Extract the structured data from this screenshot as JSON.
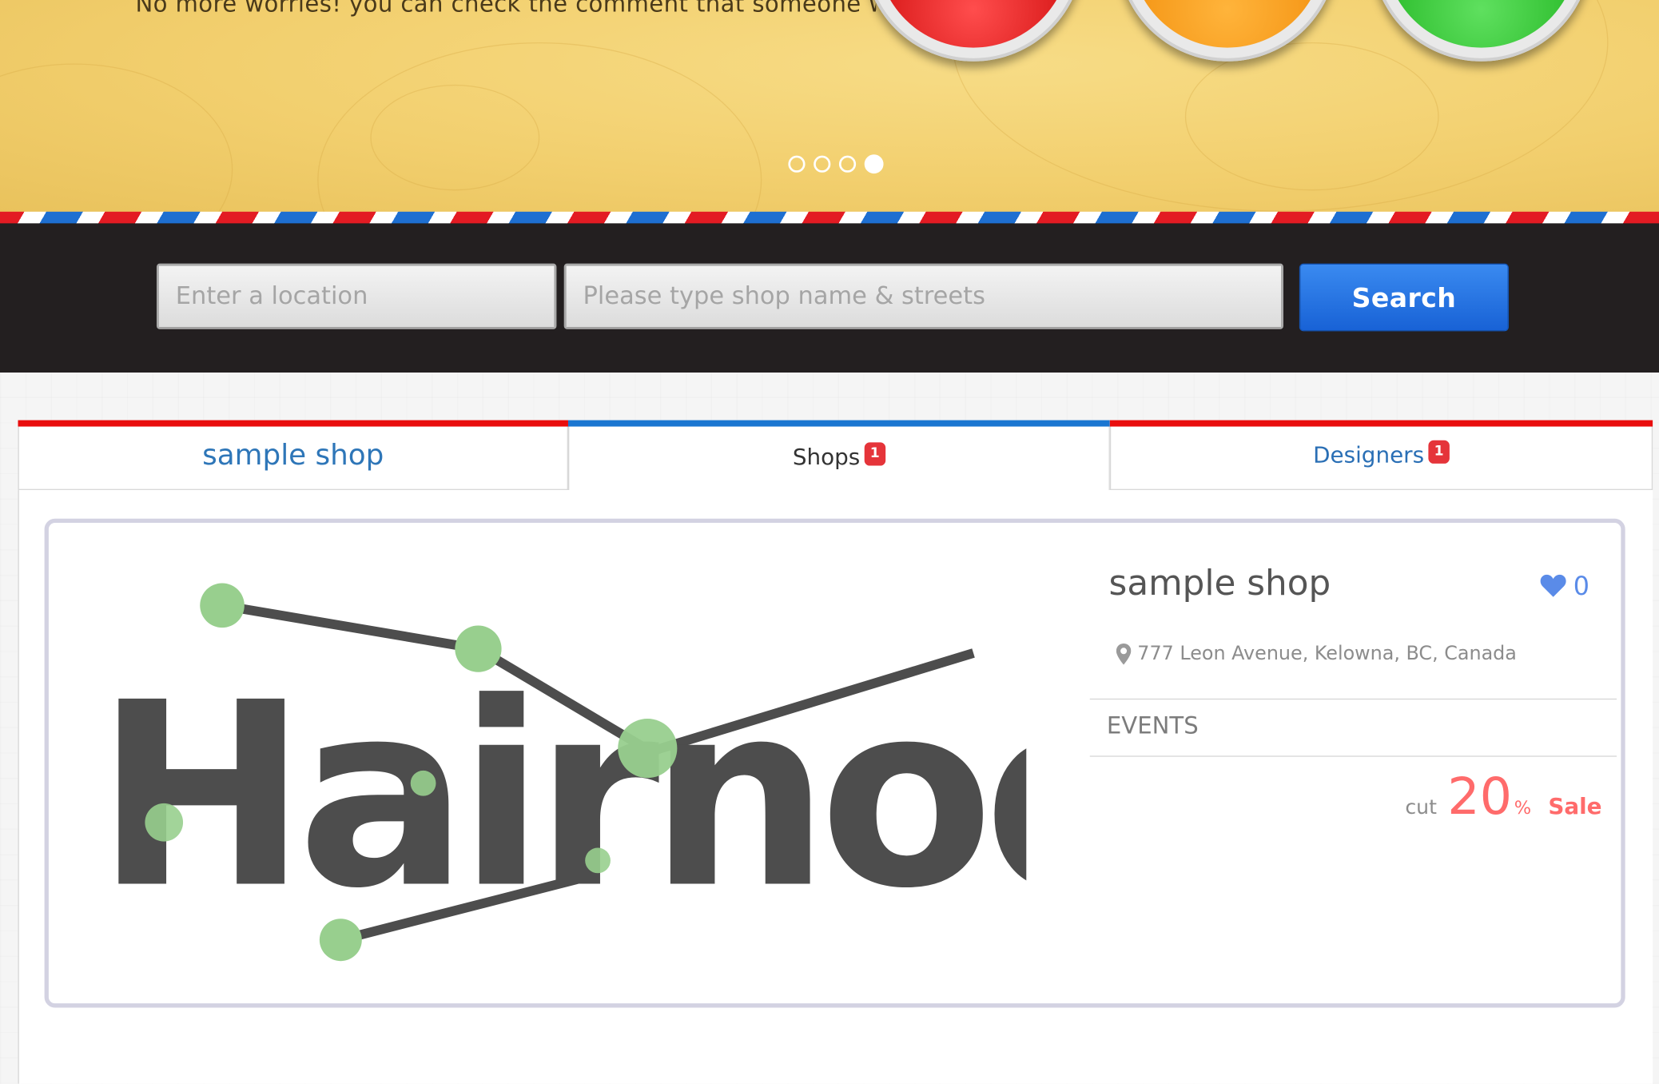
{
  "banner": {
    "text": "No more worries! you can check the comment that someone wrote",
    "carousel": {
      "slides": 4,
      "active": 4
    }
  },
  "search": {
    "location_placeholder": "Enter a location",
    "shop_placeholder": "Please type shop name & streets",
    "button_label": "Search"
  },
  "tabs": [
    {
      "label": "sample shop"
    },
    {
      "label": "Shops",
      "badge": "1"
    },
    {
      "label": "Designers",
      "badge": "1"
    }
  ],
  "shop": {
    "logo_text": "Hairnode",
    "name": "sample shop",
    "likes": "0",
    "address": "777 Leon Avenue, Kelowna, BC, Canada",
    "events_heading": "EVENTS",
    "event": {
      "prefix": "cut",
      "value": "20",
      "unit": "%",
      "suffix": "Sale"
    }
  },
  "colors": {
    "accent_blue": "#1b76d1",
    "tab_red": "#e90d0d",
    "sale": "#ff6b6b",
    "logo_green": "#98cf8e",
    "logo_gray": "#4d4d4d"
  }
}
